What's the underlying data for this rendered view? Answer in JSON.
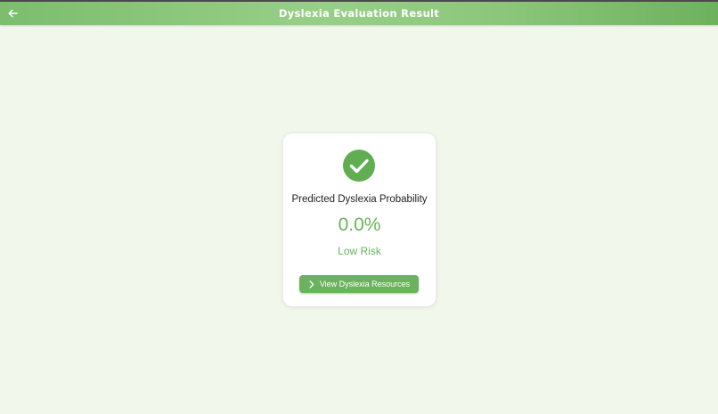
{
  "appbar": {
    "title": "Dyslexia Evaluation Result",
    "back_icon": "arrow-left-icon",
    "gradient_colors": [
      "#7cbd6e",
      "#98cf88",
      "#6db15d"
    ]
  },
  "result_card": {
    "status_icon": "check-circle-icon",
    "label": "Predicted Dyslexia Probability",
    "probability": "0.0%",
    "risk_level": "Low Risk",
    "accent_color": "#66b35a",
    "button": {
      "label": "View Dyslexia Resources",
      "icon": "chevron-right-icon",
      "color": "#6cb25e"
    }
  },
  "page_background": "#f1f7ea"
}
